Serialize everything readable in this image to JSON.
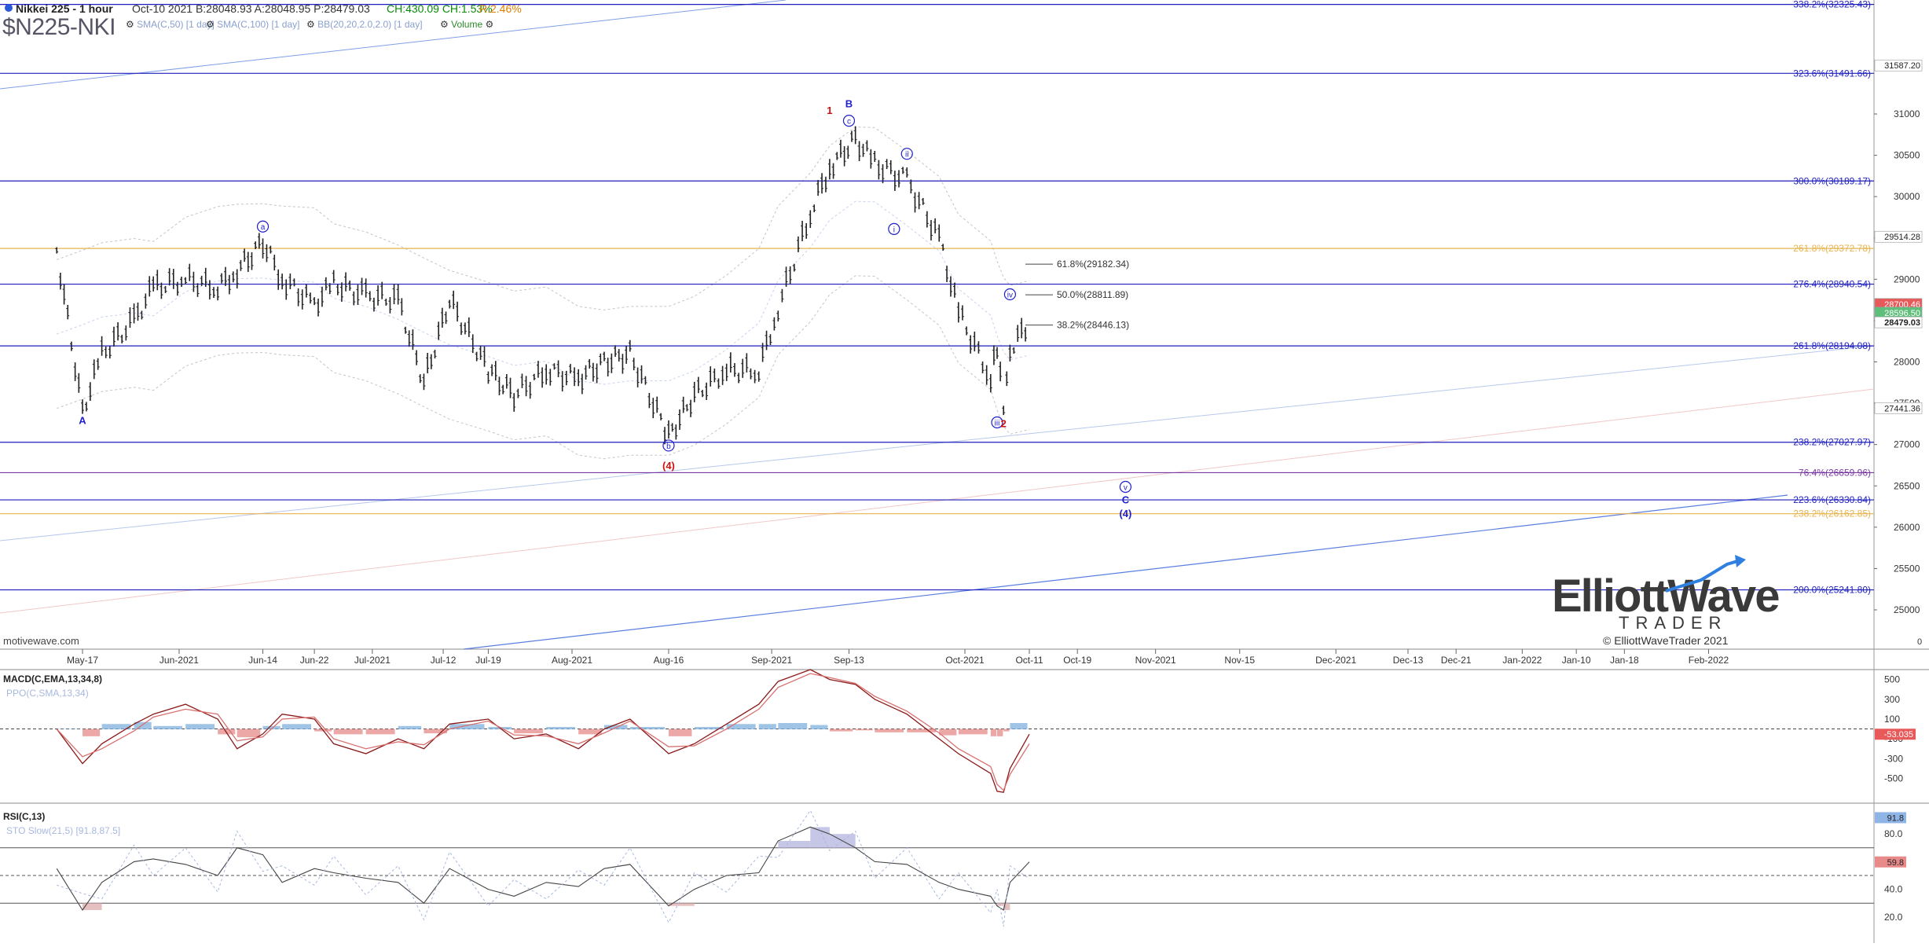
{
  "header": {
    "title": "Nikkei 225 - 1 hour",
    "quote": "Oct-10 2021  B:28048.93  A:28048.95  P:28479.03",
    "change": "CH:430.09  CH:1.53%",
    "range": "R:2.46%",
    "symbol": "$N225-NKI",
    "indicators": [
      "SMA(C,50) [1 day]",
      "SMA(C,100) [1 day]",
      "BB(20,20,2.0,2.0) [1 day]",
      "Volume"
    ]
  },
  "watermark": {
    "brand_top": "ElliottWave",
    "brand_bottom": "TRADER",
    "copyright": "© ElliottWaveTrader 2021",
    "source": "motivewave.com"
  },
  "colors": {
    "fib_blue": "#1e1ebe",
    "fib_orange": "#e6b450",
    "fib_purple": "#7a3aa6",
    "price_bar": "#222222",
    "wave_blue": "#1e1ecc",
    "wave_red": "#cc1111",
    "macd_pos": "#7fb0dc",
    "macd_neg": "#e58a8a"
  },
  "chart_data": [
    {
      "type": "line",
      "title": "Nikkei 225 - 1 hour",
      "ylim": [
        24800,
        32450
      ],
      "x_ticks": [
        "May-17",
        "Jun-2021",
        "Jun-14",
        "Jun-22",
        "Jul-2021",
        "Jul-12",
        "Jul-19",
        "Aug-2021",
        "Aug-16",
        "Sep-2021",
        "Sep-13",
        "Oct-2021",
        "Oct-11",
        "Oct-19",
        "Nov-2021",
        "Nov-15",
        "Dec-2021",
        "Dec-13",
        "Dec-21",
        "Jan-2022",
        "Jan-10",
        "Jan-18",
        "Feb-2022"
      ],
      "y_ticks": [
        25000,
        25500,
        26000,
        26500,
        27000,
        27500,
        28000,
        28500,
        29000,
        29500,
        30000,
        30500,
        31000
      ],
      "price_labels": [
        "31587.20",
        "29514.28",
        "28700.46",
        "28596.50",
        "28479.03",
        "27441.36"
      ],
      "series": [
        {
          "x": [
            "May-13",
            "May-17",
            "May-20",
            "May-25",
            "May-28",
            "Jun-2",
            "Jun-7",
            "Jun-10",
            "Jun-14",
            "Jun-17",
            "Jun-22",
            "Jun-25",
            "Jun-30",
            "Jul-5",
            "Jul-9",
            "Jul-13",
            "Jul-19",
            "Jul-23",
            "Jul-28",
            "Aug-2",
            "Aug-6",
            "Aug-10",
            "Aug-16",
            "Aug-20",
            "Aug-25",
            "Aug-30",
            "Sep-2",
            "Sep-7",
            "Sep-10",
            "Sep-14",
            "Sep-17",
            "Sep-22",
            "Sep-27",
            "Sep-30",
            "Oct-5",
            "Oct-6",
            "Oct-7",
            "Oct-8",
            "Oct-11"
          ],
          "values": [
            29350,
            27400,
            28100,
            28500,
            28900,
            29000,
            28900,
            29100,
            29450,
            29000,
            28700,
            28950,
            28800,
            28750,
            27750,
            28750,
            27900,
            27600,
            27900,
            27800,
            28000,
            28100,
            27100,
            27600,
            27900,
            27900,
            28650,
            29800,
            30350,
            30700,
            30400,
            30200,
            29500,
            28600,
            27800,
            28200,
            27500,
            28150,
            28479
          ]
        }
      ],
      "fib_levels": [
        {
          "label": "338.2%(32325.43)",
          "value": 32325.43,
          "color": "#1e1ebe"
        },
        {
          "label": "323.6%(31491.66)",
          "value": 31491.66,
          "color": "#1e1ebe"
        },
        {
          "label": "300.0%(30189.17)",
          "value": 30189.17,
          "color": "#1e1ebe"
        },
        {
          "label": "261.8%(29372.78)",
          "value": 29372.78,
          "color": "#e6b450"
        },
        {
          "label": "276.4%(28940.54)",
          "value": 28940.54,
          "color": "#1e1ebe"
        },
        {
          "label": "261.8%(28194.08)",
          "value": 28194.08,
          "color": "#1e1ebe"
        },
        {
          "label": "238.2%(27027.97)",
          "value": 27027.97,
          "color": "#1e1ebe"
        },
        {
          "label": "76.4%(26659.96)",
          "value": 26659.96,
          "color": "#7a3aa6"
        },
        {
          "label": "223.6%(26330.84)",
          "value": 26330.84,
          "color": "#1e1ebe"
        },
        {
          "label": "238.2%(26162.85)",
          "value": 26162.85,
          "color": "#e6b450"
        },
        {
          "label": "200.0%(25241.80)",
          "value": 25241.8,
          "color": "#1e1ebe"
        }
      ],
      "retracements": [
        {
          "label": "61.8%(29182.34)",
          "value": 29182.34
        },
        {
          "label": "50.0%(28811.89)",
          "value": 28811.89
        },
        {
          "label": "38.2%(28446.13)",
          "value": 28446.13
        }
      ],
      "wave_labels": [
        {
          "text": "A",
          "x": "May-17",
          "value": 27250,
          "color": "blue",
          "circled": false
        },
        {
          "text": "a",
          "x": "Jun-14",
          "value": 29600,
          "color": "blue",
          "circled": true
        },
        {
          "text": "b",
          "x": "Aug-16",
          "value": 26950,
          "color": "blue",
          "circled": true
        },
        {
          "text": "(4)",
          "x": "Aug-16",
          "value": 26700,
          "color": "red",
          "circled": false
        },
        {
          "text": "1",
          "x": "Sep-10",
          "value": 31000,
          "color": "red",
          "circled": false
        },
        {
          "text": "B",
          "x": "Sep-13",
          "value": 31080,
          "color": "blue",
          "circled": false
        },
        {
          "text": "c",
          "x": "Sep-13",
          "value": 30880,
          "color": "blue",
          "circled": true
        },
        {
          "text": "ii",
          "x": "Sep-22",
          "value": 30480,
          "color": "blue",
          "circled": true
        },
        {
          "text": "i",
          "x": "Sep-20",
          "value": 29570,
          "color": "blue",
          "circled": true
        },
        {
          "text": "iv",
          "x": "Oct-8",
          "value": 28780,
          "color": "blue",
          "circled": true
        },
        {
          "text": "iii",
          "x": "Oct-6",
          "value": 27230,
          "color": "blue",
          "circled": true
        },
        {
          "text": "2",
          "x": "Oct-7",
          "value": 27210,
          "color": "red",
          "circled": false
        },
        {
          "text": "v",
          "x": "Oct-27",
          "value": 26450,
          "color": "blue",
          "circled": true
        },
        {
          "text": "C",
          "x": "Oct-27",
          "value": 26290,
          "color": "blue",
          "circled": false
        },
        {
          "text": "(4)",
          "x": "Oct-27",
          "value": 26120,
          "color": "blue",
          "circled": false
        }
      ]
    },
    {
      "type": "line",
      "title": "MACD(C,EMA,13,34,8)",
      "subtitle": "PPO(C,SMA,13,34)",
      "ylim": [
        -750,
        600
      ],
      "y_ticks": [
        500,
        300,
        100,
        -100,
        -300,
        -500
      ],
      "current_label": "-53.035",
      "series": [
        {
          "name": "MACD",
          "values": [
            0,
            -350,
            -150,
            50,
            150,
            250,
            100,
            -200,
            -50,
            150,
            100,
            -150,
            -250,
            -100,
            -200,
            50,
            100,
            -100,
            -50,
            -200,
            0,
            100,
            -250,
            -150,
            50,
            250,
            480,
            600,
            500,
            450,
            300,
            150,
            -100,
            -250,
            -450,
            -630,
            -640,
            -400,
            -53
          ]
        },
        {
          "name": "Signal",
          "values": [
            0,
            -280,
            -200,
            -20,
            120,
            200,
            150,
            -120,
            -80,
            100,
            120,
            -100,
            -200,
            -130,
            -160,
            0,
            80,
            -60,
            -70,
            -150,
            -40,
            80,
            -180,
            -170,
            0,
            200,
            420,
            560,
            520,
            460,
            330,
            180,
            -40,
            -200,
            -380,
            -560,
            -620,
            -460,
            -150
          ]
        },
        {
          "name": "Histogram",
          "values": [
            0,
            -70,
            50,
            70,
            30,
            50,
            -50,
            -80,
            30,
            50,
            -20,
            -50,
            -50,
            30,
            -40,
            50,
            20,
            -40,
            20,
            -50,
            40,
            20,
            -70,
            20,
            50,
            50,
            60,
            40,
            -20,
            -10,
            -30,
            -30,
            -60,
            -50,
            -70,
            -70,
            -20,
            60,
            97
          ]
        }
      ]
    },
    {
      "type": "line",
      "title": "RSI(C,13)",
      "subtitle": "STO Slow(21,5) [91.8,87.5]",
      "ylim": [
        0,
        100
      ],
      "y_ticks": [
        80.0,
        60.0,
        40.0,
        20.0
      ],
      "levels": [
        70,
        50,
        30
      ],
      "current_labels": [
        "91.8",
        "59.8"
      ],
      "series": [
        {
          "name": "RSI",
          "values": [
            55,
            25,
            45,
            60,
            62,
            58,
            50,
            70,
            65,
            45,
            55,
            52,
            48,
            45,
            30,
            55,
            40,
            35,
            45,
            42,
            55,
            58,
            28,
            40,
            50,
            52,
            75,
            85,
            80,
            70,
            60,
            58,
            45,
            40,
            35,
            28,
            25,
            45,
            59.8
          ]
        }
      ]
    }
  ]
}
